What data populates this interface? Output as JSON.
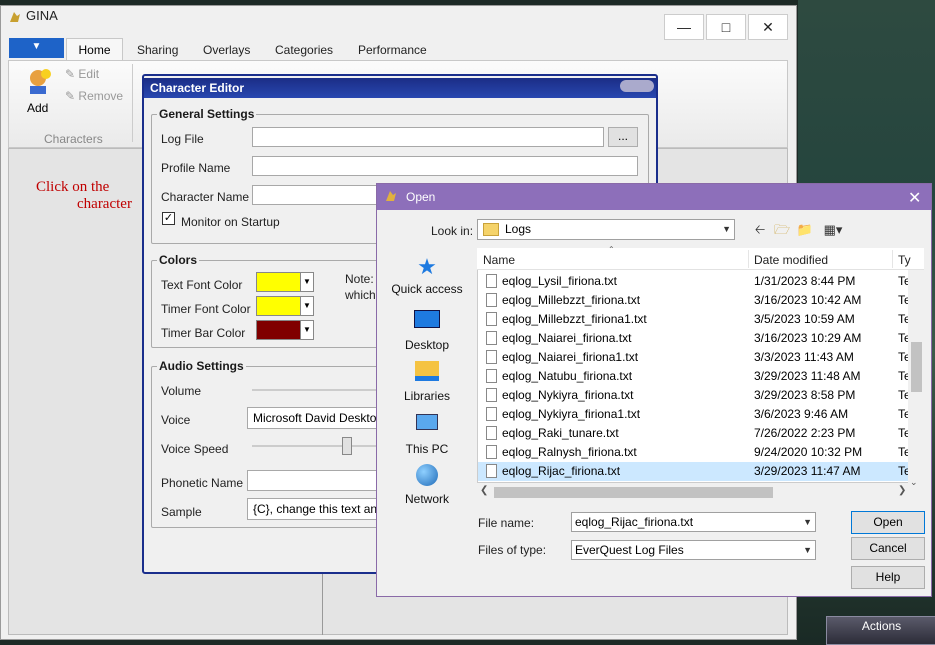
{
  "gina": {
    "title": "GINA",
    "tabs": [
      "Home",
      "Sharing",
      "Overlays",
      "Categories",
      "Performance"
    ],
    "ribbon": {
      "add_label": "Add",
      "edit_label": "Edit",
      "remove_label": "Remove",
      "group_label": "Characters"
    },
    "hint_line1": "Click on the",
    "hint_line2": "character"
  },
  "character_editor": {
    "title": "Character Editor",
    "general": {
      "title": "General Settings",
      "log_file_label": "Log File",
      "browse_label": "...",
      "profile_name_label": "Profile Name",
      "character_name_label": "Character Name",
      "monitor_label": "Monitor on Startup",
      "monitor_checked": true
    },
    "colors": {
      "title": "Colors",
      "text_font_label": "Text Font Color",
      "timer_font_label": "Timer Font Color",
      "timer_bar_label": "Timer Bar Color",
      "text_font_color": "#ffff00",
      "timer_font_color": "#ffff00",
      "timer_bar_color": "#800000",
      "note_line1": "Note:",
      "note_line2": "which"
    },
    "audio": {
      "title": "Audio Settings",
      "volume_label": "Volume",
      "voice_label": "Voice",
      "voice_value": "Microsoft David Deskto",
      "voice_speed_label": "Voice Speed",
      "phonetic_label": "Phonetic Name",
      "sample_label": "Sample",
      "sample_value": "{C}, change this text and"
    }
  },
  "open_dialog": {
    "title": "Open",
    "look_in_label": "Look in:",
    "look_in_value": "Logs",
    "places": [
      "Quick access",
      "Desktop",
      "Libraries",
      "This PC",
      "Network"
    ],
    "columns": {
      "name": "Name",
      "date": "Date modified",
      "type": "Ty"
    },
    "files": [
      {
        "name": "eqlog_Lysil_firiona.txt",
        "date": "1/31/2023 8:44 PM",
        "type": "Te"
      },
      {
        "name": "eqlog_Millebzzt_firiona.txt",
        "date": "3/16/2023 10:42 AM",
        "type": "Te"
      },
      {
        "name": "eqlog_Millebzzt_firiona1.txt",
        "date": "3/5/2023 10:59 AM",
        "type": "Te"
      },
      {
        "name": "eqlog_Naiarei_firiona.txt",
        "date": "3/16/2023 10:29 AM",
        "type": "Te"
      },
      {
        "name": "eqlog_Naiarei_firiona1.txt",
        "date": "3/3/2023 11:43 AM",
        "type": "Te"
      },
      {
        "name": "eqlog_Natubu_firiona.txt",
        "date": "3/29/2023 11:48 AM",
        "type": "Te"
      },
      {
        "name": "eqlog_Nykiyra_firiona.txt",
        "date": "3/29/2023 8:58 PM",
        "type": "Te"
      },
      {
        "name": "eqlog_Nykiyra_firiona1.txt",
        "date": "3/6/2023 9:46 AM",
        "type": "Te"
      },
      {
        "name": "eqlog_Raki_tunare.txt",
        "date": "7/26/2022 2:23 PM",
        "type": "Te"
      },
      {
        "name": "eqlog_Ralnysh_firiona.txt",
        "date": "9/24/2020 10:32 PM",
        "type": "Te"
      },
      {
        "name": "eqlog_Rijac_firiona.txt",
        "date": "3/29/2023 11:47 AM",
        "type": "Te"
      }
    ],
    "file_name_label": "File name:",
    "file_name_value": "eqlog_Rijac_firiona.txt",
    "file_type_label": "Files of type:",
    "file_type_value": "EverQuest Log Files",
    "open_label": "Open",
    "cancel_label": "Cancel",
    "help_label": "Help"
  },
  "game": {
    "actions_label": "Actions"
  }
}
